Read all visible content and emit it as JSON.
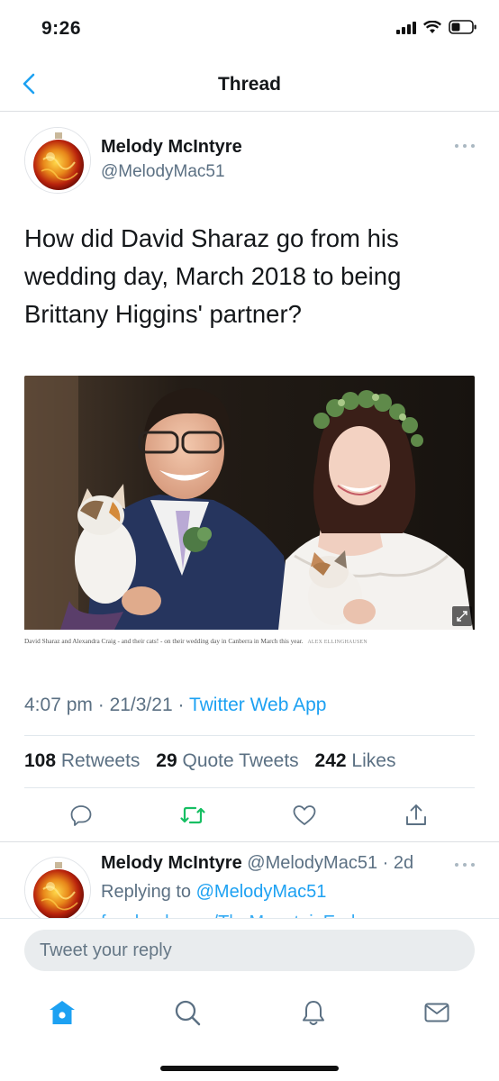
{
  "status_bar": {
    "time": "9:26",
    "icons": [
      "signal-icon",
      "wifi-icon",
      "battery-icon"
    ]
  },
  "nav": {
    "title": "Thread",
    "back_icon": "chevron-left-icon"
  },
  "tweet": {
    "name": "Melody McIntyre",
    "handle": "@MelodyMac51",
    "text": "How did David Sharaz go from his wedding day, March 2018 to being Brittany Higgins'  partner?",
    "media": {
      "caption": "David Sharaz and Alexandra Craig - and their cats! - on their wedding day in Canberra in March this year.",
      "credit": "ALEX ELLINGHAUSEN"
    },
    "time": "4:07 pm",
    "date": "21/3/21",
    "source": "Twitter Web App",
    "stats": {
      "retweets_count": "108",
      "retweets_label": "Retweets",
      "quotes_count": "29",
      "quotes_label": "Quote Tweets",
      "likes_count": "242",
      "likes_label": "Likes"
    },
    "actions": [
      "reply-icon",
      "retweet-icon",
      "like-icon",
      "share-icon"
    ]
  },
  "reply": {
    "name": "Melody McIntyre",
    "handle": "@MelodyMac51",
    "age": "2d",
    "replying_prefix": "Replying to",
    "replying_to": "@MelodyMac51",
    "truncated_text": "facebook.com/TheMountainEnd..."
  },
  "compose": {
    "placeholder": "Tweet your reply"
  },
  "tabs": [
    {
      "name": "home",
      "icon": "home-icon"
    },
    {
      "name": "search",
      "icon": "search-icon"
    },
    {
      "name": "notifications",
      "icon": "bell-icon"
    },
    {
      "name": "messages",
      "icon": "mail-icon"
    }
  ],
  "colors": {
    "accent": "#1da1f2",
    "retweet_green": "#17bf63",
    "text_primary": "#14171a",
    "text_secondary": "#5b7083",
    "compose_bg": "#e9ecee"
  }
}
